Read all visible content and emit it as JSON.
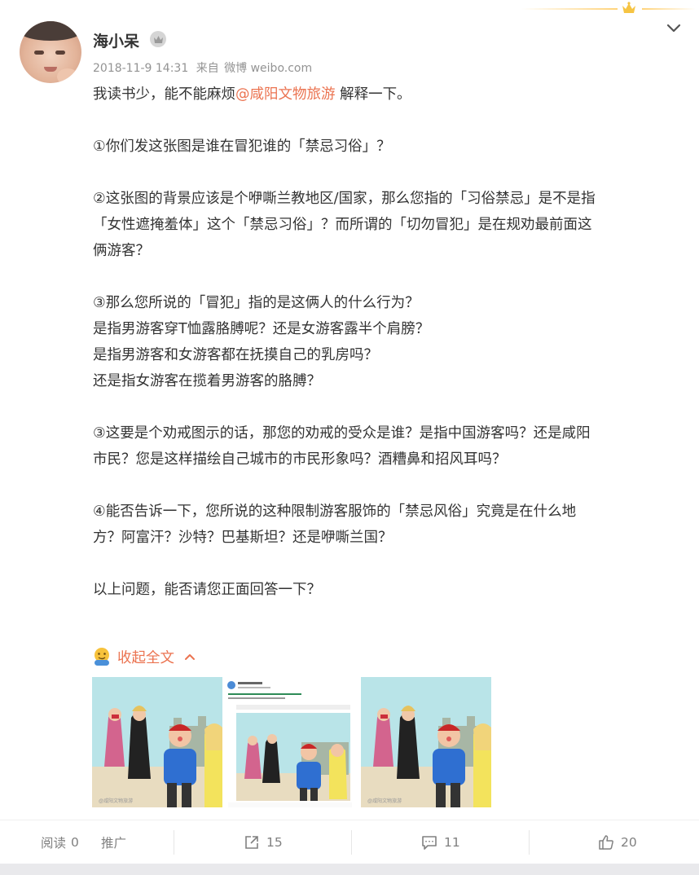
{
  "user": {
    "name": "海小呆"
  },
  "meta": {
    "date": "2018-11-9 14:31",
    "from_label": "来自",
    "source": "微博 weibo.com"
  },
  "post": {
    "p1_pre": "我读书少，能不能麻烦",
    "mention": "@咸阳文物旅游",
    "p1_post": " 解释一下。",
    "p2": "①你们发这张图是谁在冒犯谁的「禁忌习俗」？",
    "p3_l1": "②这张图的背景应该是个咿嘶兰教地区/国家，那么您指的「习俗禁忌」是不是指",
    "p3_l2": "「女性遮掩羞体」这个「禁忌习俗」？而所谓的「切勿冒犯」是在规劝最前面这",
    "p3_l3": "俩游客？",
    "p4_l1": "③那么您所说的「冒犯」指的是这俩人的什么行为？",
    "p4_l2": "是指男游客穿T恤露胳膊呢？还是女游客露半个肩膀？",
    "p4_l3": "是指男游客和女游客都在抚摸自己的乳房吗？",
    "p4_l4": "还是指女游客在揽着男游客的胳膊？",
    "p5_l1": "③这要是个劝戒图示的话，那您的劝戒的受众是谁？是指中国游客吗？还是咸阳",
    "p5_l2": "市民？您是这样描绘自己城市的市民形象吗？酒糟鼻和招风耳吗？",
    "p6_l1": "④能否告诉一下，您所说的这种限制游客服饰的「禁忌风俗」究竟是在什么地",
    "p6_l2": "方？阿富汗？沙特？巴基斯坦？还是咿嘶兰国？",
    "p7": "以上问题，能否请您正面回答一下？"
  },
  "collapse_label": "收起全文",
  "actions": {
    "reads_label": "阅读",
    "reads": "0",
    "promote_label": "推广",
    "reposts": "15",
    "comments": "11",
    "likes": "20"
  },
  "colors": {
    "accent": "#eb7350",
    "text": "#333333",
    "muted": "#939393"
  },
  "icons": [
    "crown-icon",
    "chevron-down-icon",
    "vip-badge-icon",
    "emoji-icon",
    "chevron-up-icon",
    "repost-icon",
    "comment-icon",
    "like-icon"
  ]
}
